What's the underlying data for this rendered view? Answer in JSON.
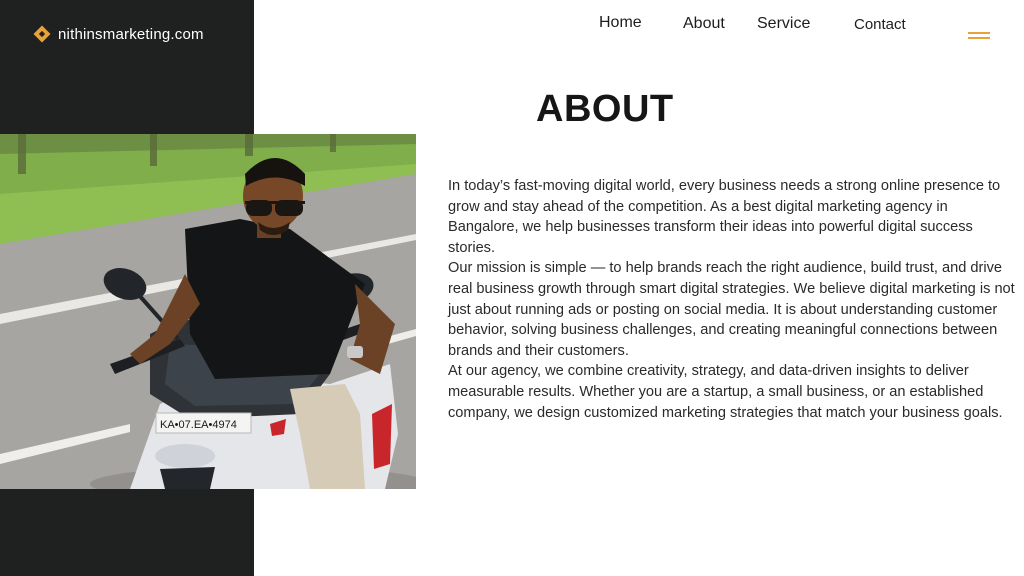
{
  "brand": {
    "site_name": "nithinsmarketing.com",
    "accent_color": "#e9a23b",
    "dark_color": "#1f2020",
    "logo_icon": "diamond-logo-icon"
  },
  "nav": {
    "items": [
      {
        "label": "Home"
      },
      {
        "label": "About"
      },
      {
        "label": "Service"
      },
      {
        "label": "Contact"
      }
    ],
    "menu_icon": "hamburger-menu-icon"
  },
  "about": {
    "title": "ABOUT",
    "photo_plate": "KA•07.EA•4974",
    "paragraphs": [
      "In today’s fast-moving digital world, every business needs a strong online presence to grow and stay ahead of the competition. As a best digital marketing agency in Bangalore, we help businesses transform their ideas into powerful digital success stories.",
      "Our mission is simple — to help brands reach the right audience, build trust, and drive real business growth through smart digital strategies. We believe digital marketing is not just about running ads or posting on social media. It is about understanding customer behavior, solving business challenges, and creating meaningful connections between brands and their customers.",
      "At our agency, we combine creativity, strategy, and data-driven insights to deliver measurable results. Whether you are a startup, a small business, or an established company, we design customized marketing strategies that match your business goals."
    ]
  }
}
